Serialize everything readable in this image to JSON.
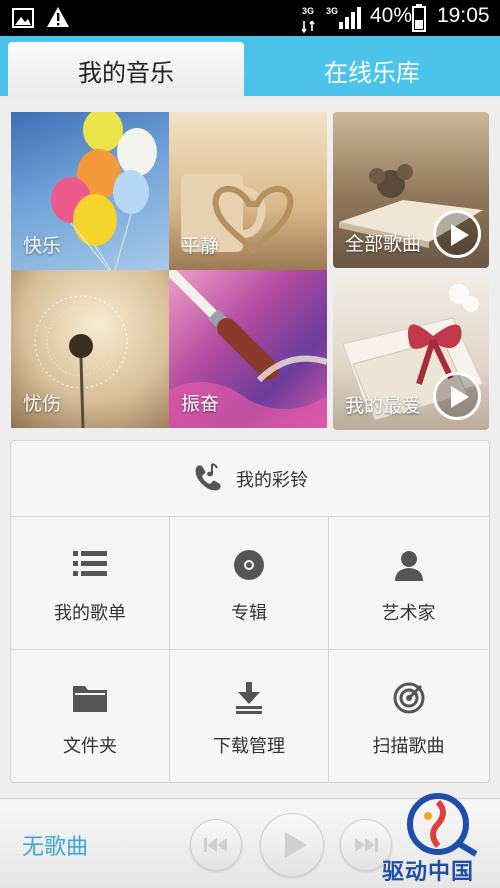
{
  "status_bar": {
    "network_1": "3G",
    "network_2": "3G",
    "battery": "40%",
    "time": "19:05"
  },
  "tabs": [
    {
      "label": "我的音乐",
      "active": true
    },
    {
      "label": "在线乐库",
      "active": false
    }
  ],
  "tiles": [
    {
      "label": "快乐"
    },
    {
      "label": "平静"
    },
    {
      "label": "全部歌曲"
    },
    {
      "label": "忧伤"
    },
    {
      "label": "振奋"
    },
    {
      "label": "我的最爱"
    }
  ],
  "grid": {
    "ringtone": "我的彩铃",
    "items": [
      {
        "label": "我的歌单",
        "icon": "list-icon"
      },
      {
        "label": "专辑",
        "icon": "disc-icon"
      },
      {
        "label": "艺术家",
        "icon": "person-icon"
      },
      {
        "label": "文件夹",
        "icon": "folder-icon"
      },
      {
        "label": "下载管理",
        "icon": "download-icon"
      },
      {
        "label": "扫描歌曲",
        "icon": "scan-icon"
      }
    ]
  },
  "player": {
    "song": "无歌曲"
  },
  "watermark": {
    "text": "驱动中国"
  },
  "colors": {
    "accent": "#4cc3ea",
    "song_text": "#3aa7d6"
  }
}
